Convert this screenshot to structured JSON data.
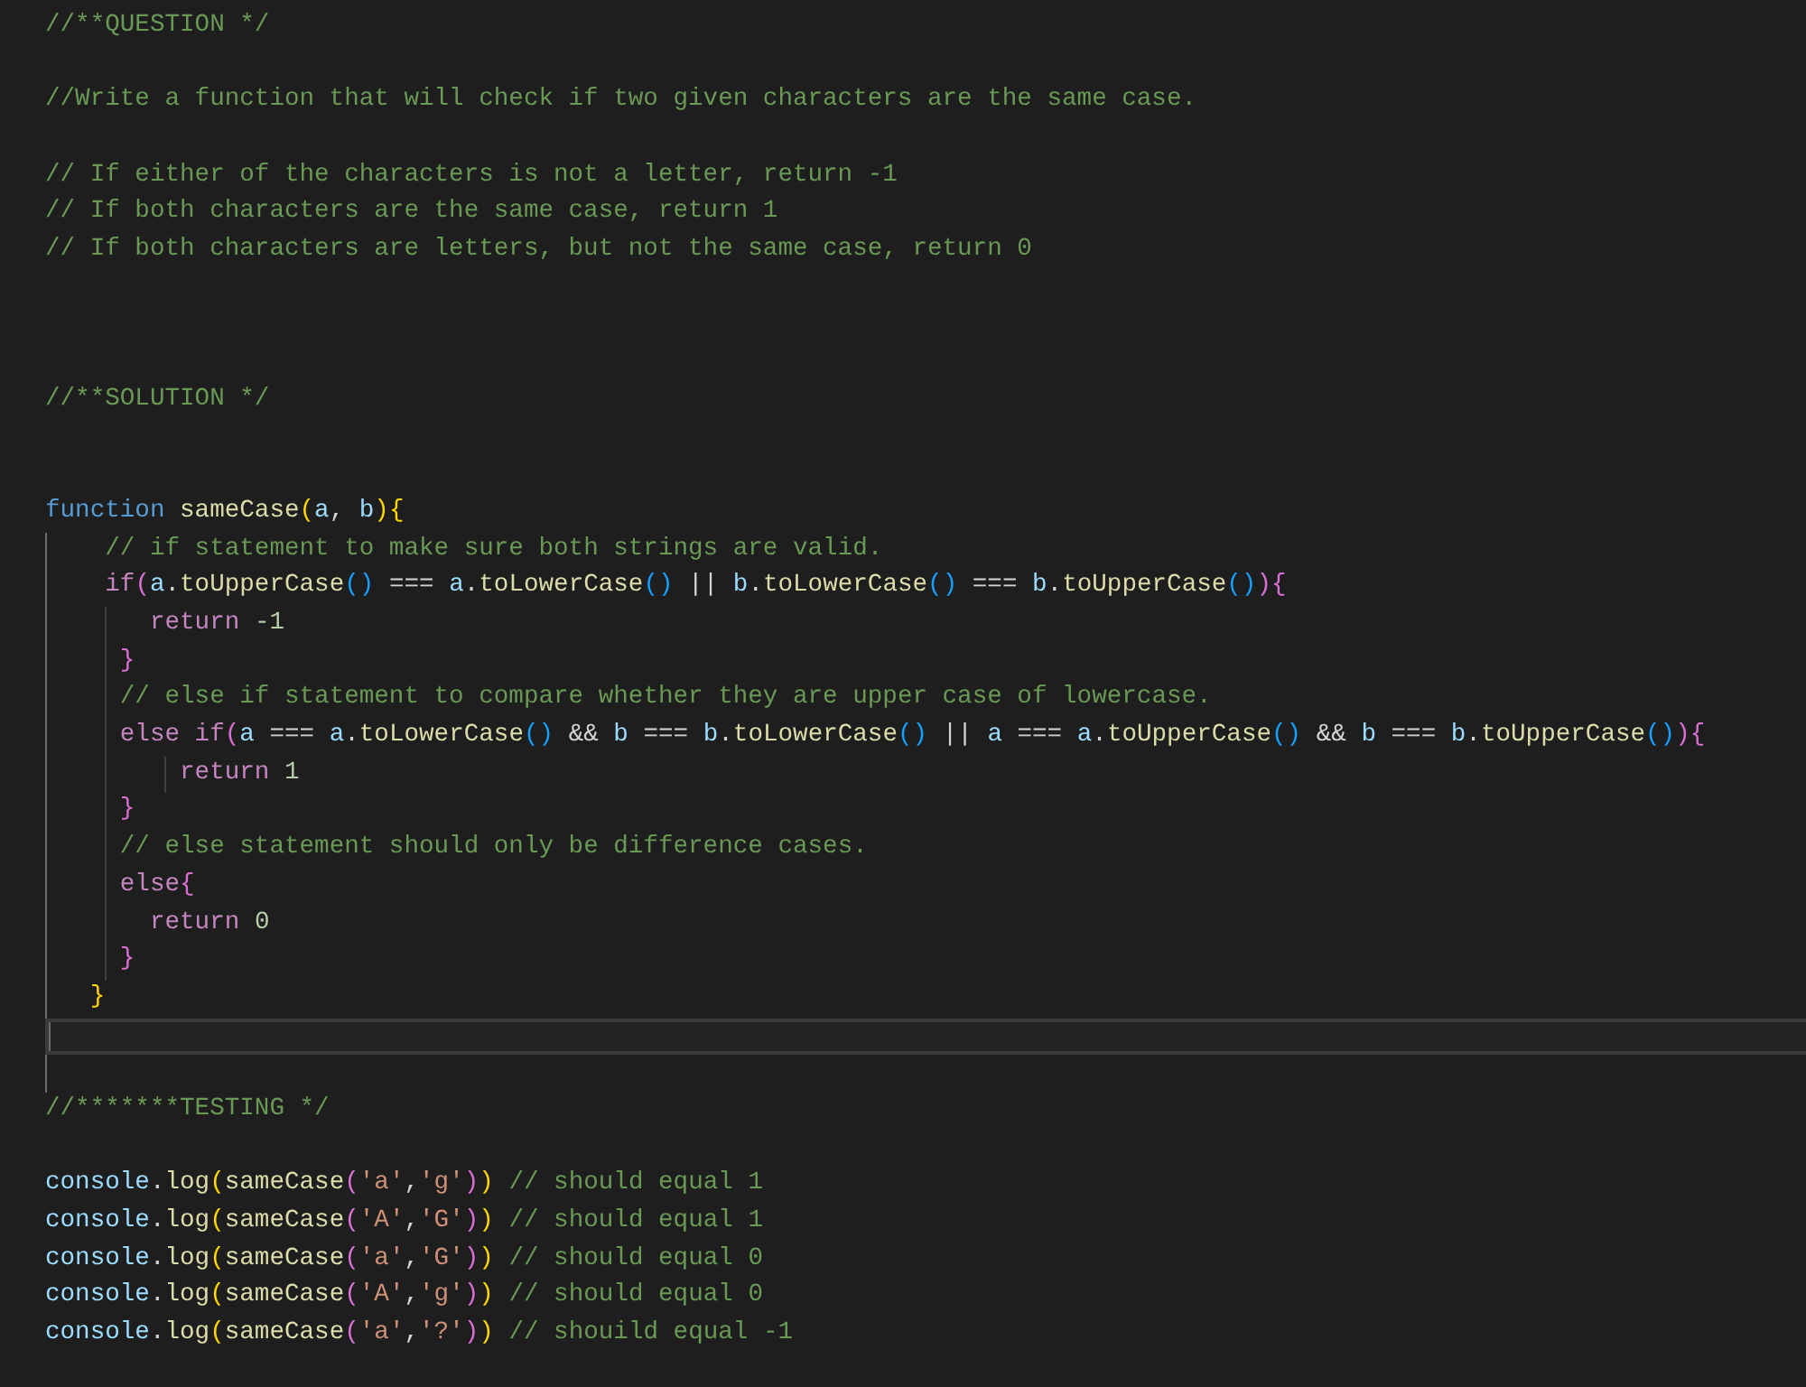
{
  "editor": {
    "lines": [
      {
        "kind": "code",
        "current": false,
        "tokens": [
          {
            "kind": "comment",
            "text": "//**QUESTION */"
          }
        ]
      },
      {
        "kind": "blank",
        "current": false
      },
      {
        "kind": "code",
        "current": false,
        "tokens": [
          {
            "kind": "comment",
            "text": "//Write a function that will check if two given characters are the same case."
          }
        ]
      },
      {
        "kind": "blank",
        "current": false
      },
      {
        "kind": "code",
        "current": false,
        "tokens": [
          {
            "kind": "comment",
            "text": "// If either of the characters is not a letter, return -1"
          }
        ]
      },
      {
        "kind": "code",
        "current": false,
        "tokens": [
          {
            "kind": "comment",
            "text": "// If both characters are the same case, return 1"
          }
        ]
      },
      {
        "kind": "code",
        "current": false,
        "tokens": [
          {
            "kind": "comment",
            "text": "// If both characters are letters, but not the same case, return 0"
          }
        ]
      },
      {
        "kind": "blank",
        "current": false
      },
      {
        "kind": "blank",
        "current": false
      },
      {
        "kind": "blank",
        "current": false
      },
      {
        "kind": "code",
        "current": false,
        "tokens": [
          {
            "kind": "comment",
            "text": "//**SOLUTION */"
          }
        ]
      },
      {
        "kind": "blank",
        "current": false
      },
      {
        "kind": "blank",
        "current": false
      },
      {
        "kind": "code",
        "current": false,
        "tokens": [
          {
            "kind": "keyword",
            "text": "function "
          },
          {
            "kind": "fn",
            "text": "sameCase"
          },
          {
            "kind": "brace1",
            "text": "("
          },
          {
            "kind": "var",
            "text": "a"
          },
          {
            "kind": "punct",
            "text": ", "
          },
          {
            "kind": "var",
            "text": "b"
          },
          {
            "kind": "brace1",
            "text": ")"
          },
          {
            "kind": "brace1",
            "text": "{"
          }
        ]
      },
      {
        "kind": "code",
        "current": false,
        "tokens": [
          {
            "kind": "comment",
            "text": "    // if statement to make sure both strings are valid."
          }
        ]
      },
      {
        "kind": "code",
        "current": false,
        "tokens": [
          {
            "kind": "control",
            "text": "    if"
          },
          {
            "kind": "brace2",
            "text": "("
          },
          {
            "kind": "var",
            "text": "a"
          },
          {
            "kind": "punct",
            "text": "."
          },
          {
            "kind": "fn",
            "text": "toUpperCase"
          },
          {
            "kind": "brace3",
            "text": "()"
          },
          {
            "kind": "punct",
            "text": " === "
          },
          {
            "kind": "var",
            "text": "a"
          },
          {
            "kind": "punct",
            "text": "."
          },
          {
            "kind": "fn",
            "text": "toLowerCase"
          },
          {
            "kind": "brace3",
            "text": "()"
          },
          {
            "kind": "punct",
            "text": " || "
          },
          {
            "kind": "var",
            "text": "b"
          },
          {
            "kind": "punct",
            "text": "."
          },
          {
            "kind": "fn",
            "text": "toLowerCase"
          },
          {
            "kind": "brace3",
            "text": "()"
          },
          {
            "kind": "punct",
            "text": " === "
          },
          {
            "kind": "var",
            "text": "b"
          },
          {
            "kind": "punct",
            "text": "."
          },
          {
            "kind": "fn",
            "text": "toUpperCase"
          },
          {
            "kind": "brace3",
            "text": "()"
          },
          {
            "kind": "brace2",
            "text": ")"
          },
          {
            "kind": "brace2",
            "text": "{"
          }
        ]
      },
      {
        "kind": "code",
        "current": false,
        "tokens": [
          {
            "kind": "control",
            "text": "       return "
          },
          {
            "kind": "num",
            "text": "-1"
          }
        ]
      },
      {
        "kind": "code",
        "current": false,
        "tokens": [
          {
            "kind": "brace2",
            "text": "     }"
          }
        ]
      },
      {
        "kind": "code",
        "current": false,
        "tokens": [
          {
            "kind": "comment",
            "text": "     // else if statement to compare whether they are upper case of lowercase."
          }
        ]
      },
      {
        "kind": "code",
        "current": false,
        "tokens": [
          {
            "kind": "control",
            "text": "     else if"
          },
          {
            "kind": "brace2",
            "text": "("
          },
          {
            "kind": "var",
            "text": "a"
          },
          {
            "kind": "punct",
            "text": " === "
          },
          {
            "kind": "var",
            "text": "a"
          },
          {
            "kind": "punct",
            "text": "."
          },
          {
            "kind": "fn",
            "text": "toLowerCase"
          },
          {
            "kind": "brace3",
            "text": "()"
          },
          {
            "kind": "punct",
            "text": " && "
          },
          {
            "kind": "var",
            "text": "b"
          },
          {
            "kind": "punct",
            "text": " === "
          },
          {
            "kind": "var",
            "text": "b"
          },
          {
            "kind": "punct",
            "text": "."
          },
          {
            "kind": "fn",
            "text": "toLowerCase"
          },
          {
            "kind": "brace3",
            "text": "()"
          },
          {
            "kind": "punct",
            "text": " || "
          },
          {
            "kind": "var",
            "text": "a"
          },
          {
            "kind": "punct",
            "text": " === "
          },
          {
            "kind": "var",
            "text": "a"
          },
          {
            "kind": "punct",
            "text": "."
          },
          {
            "kind": "fn",
            "text": "toUpperCase"
          },
          {
            "kind": "brace3",
            "text": "()"
          },
          {
            "kind": "punct",
            "text": " && "
          },
          {
            "kind": "var",
            "text": "b"
          },
          {
            "kind": "punct",
            "text": " === "
          },
          {
            "kind": "var",
            "text": "b"
          },
          {
            "kind": "punct",
            "text": "."
          },
          {
            "kind": "fn",
            "text": "toUpperCase"
          },
          {
            "kind": "brace3",
            "text": "()"
          },
          {
            "kind": "brace2",
            "text": ")"
          },
          {
            "kind": "brace2",
            "text": "{"
          }
        ]
      },
      {
        "kind": "code",
        "current": false,
        "tokens": [
          {
            "kind": "control",
            "text": "         return "
          },
          {
            "kind": "num",
            "text": "1"
          }
        ]
      },
      {
        "kind": "code",
        "current": false,
        "tokens": [
          {
            "kind": "brace2",
            "text": "     }"
          }
        ]
      },
      {
        "kind": "code",
        "current": false,
        "tokens": [
          {
            "kind": "comment",
            "text": "     // else statement should only be difference cases."
          }
        ]
      },
      {
        "kind": "code",
        "current": false,
        "tokens": [
          {
            "kind": "control",
            "text": "     else"
          },
          {
            "kind": "brace2",
            "text": "{"
          }
        ]
      },
      {
        "kind": "code",
        "current": false,
        "tokens": [
          {
            "kind": "control",
            "text": "       return "
          },
          {
            "kind": "num",
            "text": "0"
          }
        ]
      },
      {
        "kind": "code",
        "current": false,
        "tokens": [
          {
            "kind": "brace2",
            "text": "     }"
          }
        ]
      },
      {
        "kind": "code",
        "current": false,
        "tokens": [
          {
            "kind": "brace1",
            "text": "   }"
          }
        ]
      },
      {
        "kind": "blank",
        "current": true
      },
      {
        "kind": "blank",
        "current": false
      },
      {
        "kind": "code",
        "current": false,
        "tokens": [
          {
            "kind": "comment",
            "text": "//*******TESTING */"
          }
        ]
      },
      {
        "kind": "blank",
        "current": false
      },
      {
        "kind": "code",
        "current": false,
        "tokens": [
          {
            "kind": "var",
            "text": "console"
          },
          {
            "kind": "punct",
            "text": "."
          },
          {
            "kind": "fn",
            "text": "log"
          },
          {
            "kind": "brace1",
            "text": "("
          },
          {
            "kind": "fn",
            "text": "sameCase"
          },
          {
            "kind": "brace2",
            "text": "("
          },
          {
            "kind": "str",
            "text": "'a'"
          },
          {
            "kind": "punct",
            "text": ","
          },
          {
            "kind": "str",
            "text": "'g'"
          },
          {
            "kind": "brace2",
            "text": ")"
          },
          {
            "kind": "brace1",
            "text": ") "
          },
          {
            "kind": "comment",
            "text": "// should equal 1"
          }
        ]
      },
      {
        "kind": "code",
        "current": false,
        "tokens": [
          {
            "kind": "var",
            "text": "console"
          },
          {
            "kind": "punct",
            "text": "."
          },
          {
            "kind": "fn",
            "text": "log"
          },
          {
            "kind": "brace1",
            "text": "("
          },
          {
            "kind": "fn",
            "text": "sameCase"
          },
          {
            "kind": "brace2",
            "text": "("
          },
          {
            "kind": "str",
            "text": "'A'"
          },
          {
            "kind": "punct",
            "text": ","
          },
          {
            "kind": "str",
            "text": "'G'"
          },
          {
            "kind": "brace2",
            "text": ")"
          },
          {
            "kind": "brace1",
            "text": ") "
          },
          {
            "kind": "comment",
            "text": "// should equal 1"
          }
        ]
      },
      {
        "kind": "code",
        "current": false,
        "tokens": [
          {
            "kind": "var",
            "text": "console"
          },
          {
            "kind": "punct",
            "text": "."
          },
          {
            "kind": "fn",
            "text": "log"
          },
          {
            "kind": "brace1",
            "text": "("
          },
          {
            "kind": "fn",
            "text": "sameCase"
          },
          {
            "kind": "brace2",
            "text": "("
          },
          {
            "kind": "str",
            "text": "'a'"
          },
          {
            "kind": "punct",
            "text": ","
          },
          {
            "kind": "str",
            "text": "'G'"
          },
          {
            "kind": "brace2",
            "text": ")"
          },
          {
            "kind": "brace1",
            "text": ") "
          },
          {
            "kind": "comment",
            "text": "// should equal 0"
          }
        ]
      },
      {
        "kind": "code",
        "current": false,
        "tokens": [
          {
            "kind": "var",
            "text": "console"
          },
          {
            "kind": "punct",
            "text": "."
          },
          {
            "kind": "fn",
            "text": "log"
          },
          {
            "kind": "brace1",
            "text": "("
          },
          {
            "kind": "fn",
            "text": "sameCase"
          },
          {
            "kind": "brace2",
            "text": "("
          },
          {
            "kind": "str",
            "text": "'A'"
          },
          {
            "kind": "punct",
            "text": ","
          },
          {
            "kind": "str",
            "text": "'g'"
          },
          {
            "kind": "brace2",
            "text": ")"
          },
          {
            "kind": "brace1",
            "text": ") "
          },
          {
            "kind": "comment",
            "text": "// should equal 0"
          }
        ]
      },
      {
        "kind": "code",
        "current": false,
        "tokens": [
          {
            "kind": "var",
            "text": "console"
          },
          {
            "kind": "punct",
            "text": "."
          },
          {
            "kind": "fn",
            "text": "log"
          },
          {
            "kind": "brace1",
            "text": "("
          },
          {
            "kind": "fn",
            "text": "sameCase"
          },
          {
            "kind": "brace2",
            "text": "("
          },
          {
            "kind": "str",
            "text": "'a'"
          },
          {
            "kind": "punct",
            "text": ","
          },
          {
            "kind": "str",
            "text": "'?'"
          },
          {
            "kind": "brace2",
            "text": ")"
          },
          {
            "kind": "brace1",
            "text": ") "
          },
          {
            "kind": "comment",
            "text": "// shouild equal -1"
          }
        ]
      }
    ]
  }
}
